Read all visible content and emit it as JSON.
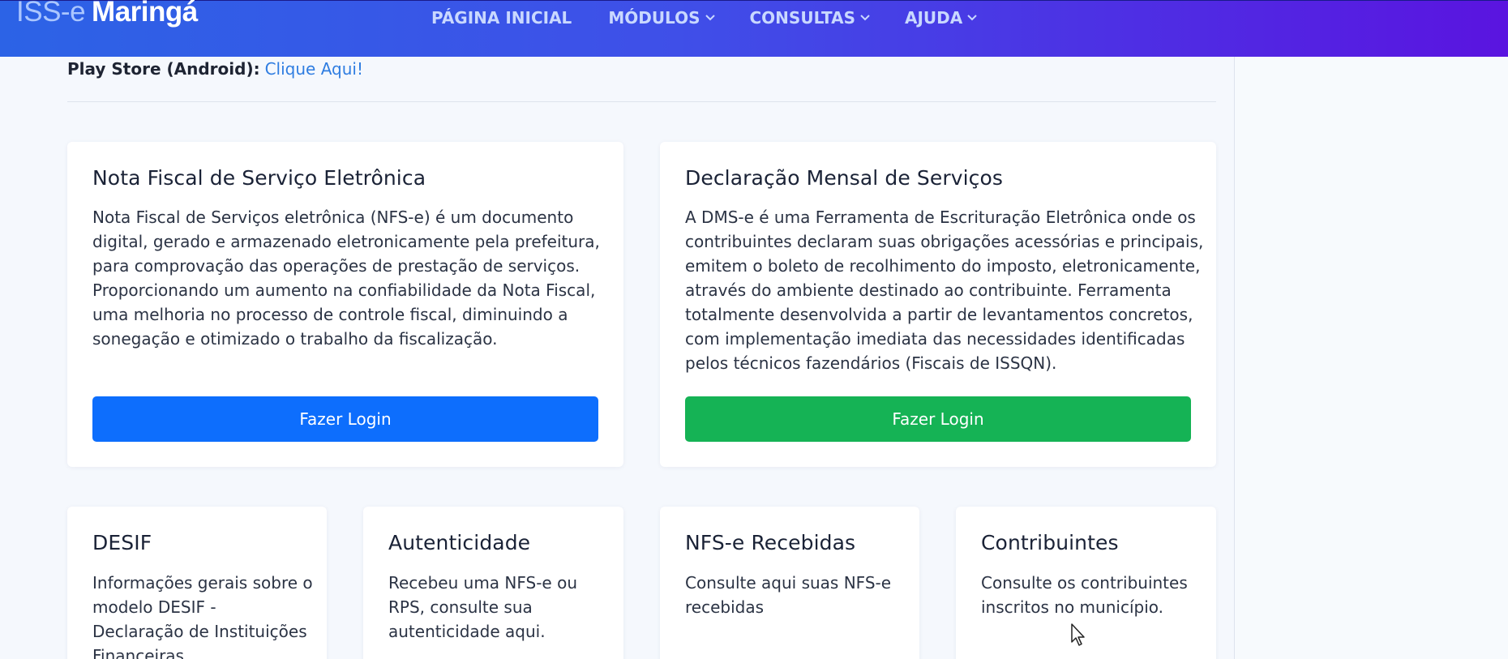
{
  "header": {
    "brand_prefix": "ISS-e",
    "brand_name": "Maringá",
    "nav": [
      {
        "label": "PÁGINA INICIAL",
        "has_dropdown": false
      },
      {
        "label": "MÓDULOS",
        "has_dropdown": true
      },
      {
        "label": "CONSULTAS",
        "has_dropdown": true
      },
      {
        "label": "AJUDA",
        "has_dropdown": true
      }
    ]
  },
  "store": {
    "label": "Play Store (Android):",
    "link": "Clique Aqui!"
  },
  "cards_main": [
    {
      "title": "Nota Fiscal de Serviço Eletrônica",
      "lines": [
        "Nota Fiscal de Serviços eletrônica (NFS-e) é um documento",
        "digital, gerado e armazenado eletronicamente pela prefeitura,",
        "para comprovação das operações de prestação de serviços.",
        "Proporcionando um aumento na confiabilidade da Nota Fiscal,",
        "uma melhoria no processo de controle fiscal, diminuindo a",
        "sonegação e otimizado o trabalho da fiscalização."
      ],
      "button": "Fazer Login",
      "button_color": "#0d6efd"
    },
    {
      "title": "Declaração Mensal de Serviços",
      "lines": [
        "A DMS-e é uma Ferramenta de Escrituração Eletrônica onde os",
        "contribuintes declaram suas obrigações acessórias e principais,",
        "emitem o boleto de recolhimento do imposto, eletronicamente,",
        "através do ambiente destinado ao contribuinte. Ferramenta",
        "totalmente desenvolvida a partir de levantamentos concretos,",
        "com implementação imediata das necessidades identificadas",
        "pelos técnicos fazendários (Fiscais de ISSQN)."
      ],
      "button": "Fazer Login",
      "button_color": "#15b355"
    }
  ],
  "cards_small": [
    {
      "title": "DESIF",
      "lines": [
        "Informações gerais sobre o",
        "modelo DESIF -",
        "Declaração de Instituições",
        "Financeiras"
      ]
    },
    {
      "title": "Autenticidade",
      "lines": [
        "Recebeu uma NFS-e ou",
        "RPS, consulte sua",
        "autenticidade aqui."
      ]
    },
    {
      "title": "NFS-e Recebidas",
      "lines": [
        "Consulte aqui suas NFS-e",
        "recebidas"
      ]
    },
    {
      "title": "Contribuintes",
      "lines": [
        "Consulte os contribuintes",
        "inscritos no município."
      ]
    }
  ]
}
